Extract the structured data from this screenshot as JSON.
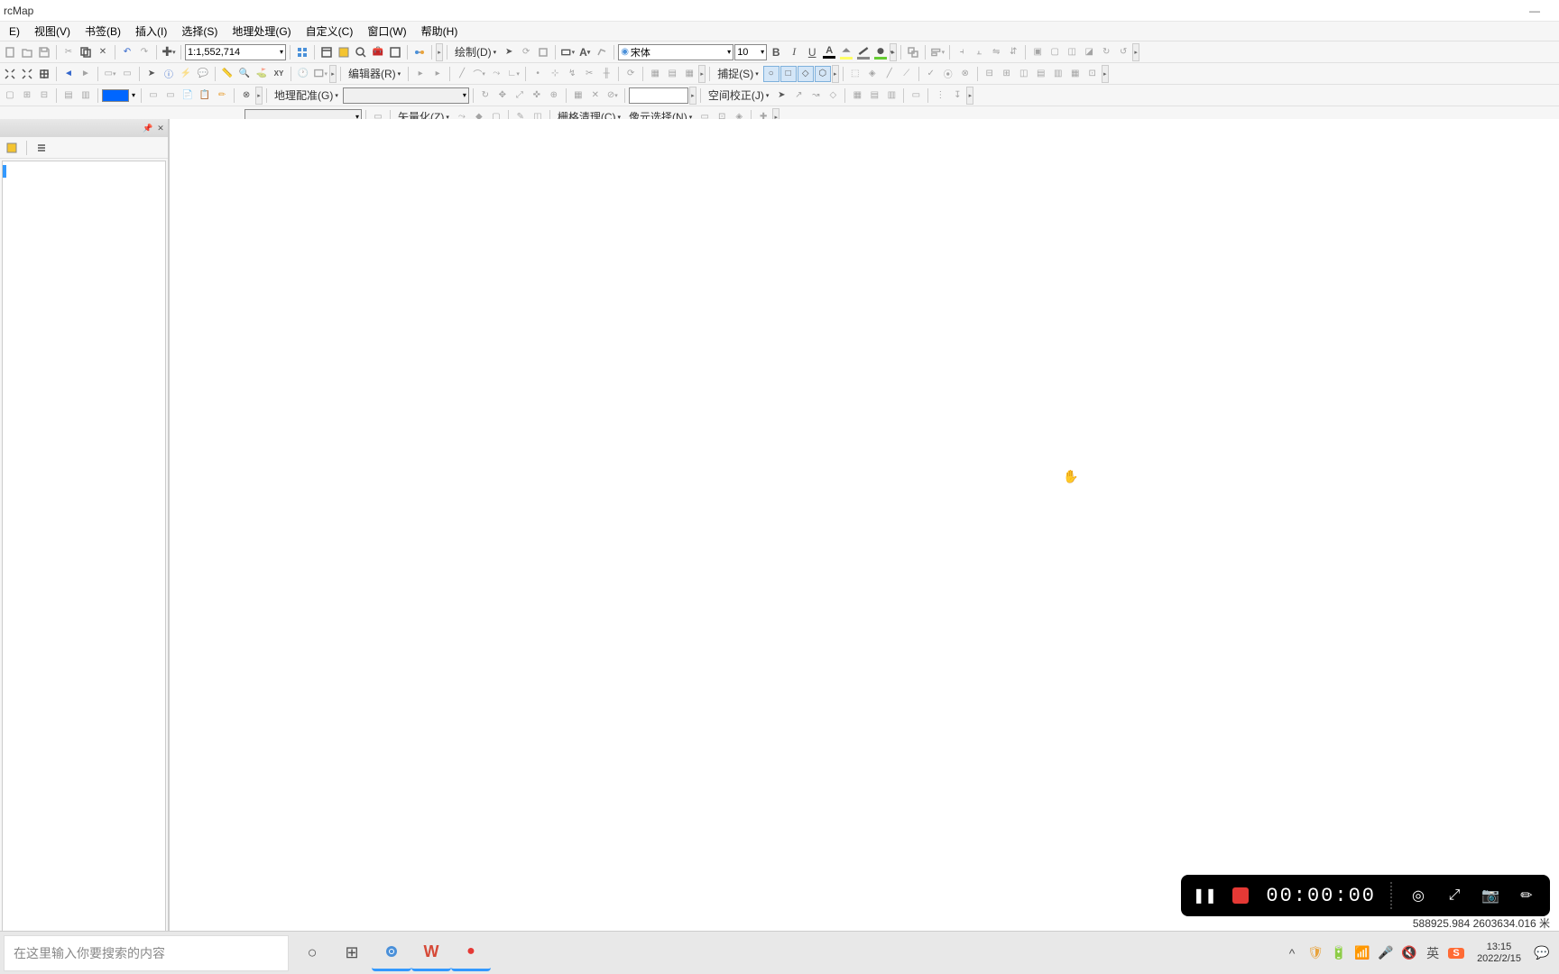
{
  "title": "rcMap",
  "menu": [
    "E)",
    "视图(V)",
    "书签(B)",
    "插入(I)",
    "选择(S)",
    "地理处理(G)",
    "自定义(C)",
    "窗口(W)",
    "帮助(H)"
  ],
  "toolbar1": {
    "scale_value": "1:1,552,714",
    "font_name": "宋体",
    "font_size": "10",
    "draw_label": "绘制(D)",
    "bold": "B",
    "italic": "I",
    "underline": "U",
    "text_color": "#000000",
    "highlight_color": "#ffff66",
    "fill_color": "#66cc33"
  },
  "toolbar2": {
    "editor_label": "编辑器(R)",
    "snap_label": "捕捉(S)"
  },
  "toolbar3": {
    "georef_label": "地理配准(G)",
    "georef_combo": "",
    "spatial_adj_label": "空间校正(J)",
    "fill_color": "#0066ff",
    "search_value": ""
  },
  "toolbar4": {
    "vectorize_label": "矢量化(Z)",
    "raster_clean_label": "栅格清理(C)",
    "pixel_sel_label": "像元选择(N)",
    "combo_value": ""
  },
  "recorder": {
    "time": "00:00:00"
  },
  "status": {
    "coords": "588925.984  2603634.016 米"
  },
  "taskbar": {
    "search_placeholder": "在这里输入你要搜索的内容",
    "clock_time": "13:15",
    "clock_date": "2022/2/15"
  }
}
